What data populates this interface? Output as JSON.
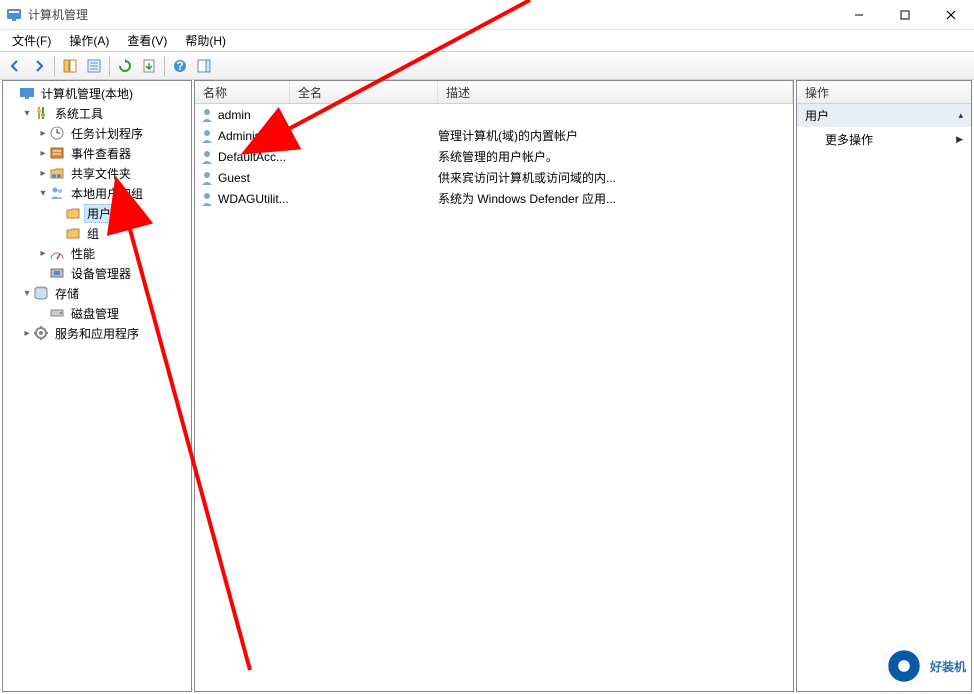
{
  "window": {
    "title": "计算机管理"
  },
  "menu": {
    "file": "文件(F)",
    "action": "操作(A)",
    "view": "查看(V)",
    "help": "帮助(H)"
  },
  "toolbar_icons": {
    "back": "back-arrow",
    "forward": "forward-arrow",
    "up": "pane-toggle",
    "props": "properties",
    "refresh": "refresh",
    "export": "export-list",
    "help": "help",
    "actionpane": "action-pane-toggle"
  },
  "tree": {
    "root": "计算机管理(本地)",
    "system_tools": "系统工具",
    "task_scheduler": "任务计划程序",
    "event_viewer": "事件查看器",
    "shared_folders": "共享文件夹",
    "local_users_groups": "本地用户和组",
    "users": "用户",
    "groups": "组",
    "performance": "性能",
    "device_manager": "设备管理器",
    "storage": "存储",
    "disk_management": "磁盘管理",
    "services_apps": "服务和应用程序"
  },
  "list": {
    "col_name": "名称",
    "col_fullname": "全名",
    "col_desc": "描述",
    "rows": [
      {
        "name": "admin",
        "full": "",
        "desc": ""
      },
      {
        "name": "Administrat...",
        "full": "",
        "desc": "管理计算机(域)的内置帐户"
      },
      {
        "name": "DefaultAcc...",
        "full": "",
        "desc": "系统管理的用户帐户。"
      },
      {
        "name": "Guest",
        "full": "",
        "desc": "供来宾访问计算机或访问域的内..."
      },
      {
        "name": "WDAGUtilit...",
        "full": "",
        "desc": "系统为 Windows Defender 应用..."
      }
    ]
  },
  "actions": {
    "header": "操作",
    "group": "用户",
    "more": "更多操作"
  },
  "watermark": "好装机"
}
